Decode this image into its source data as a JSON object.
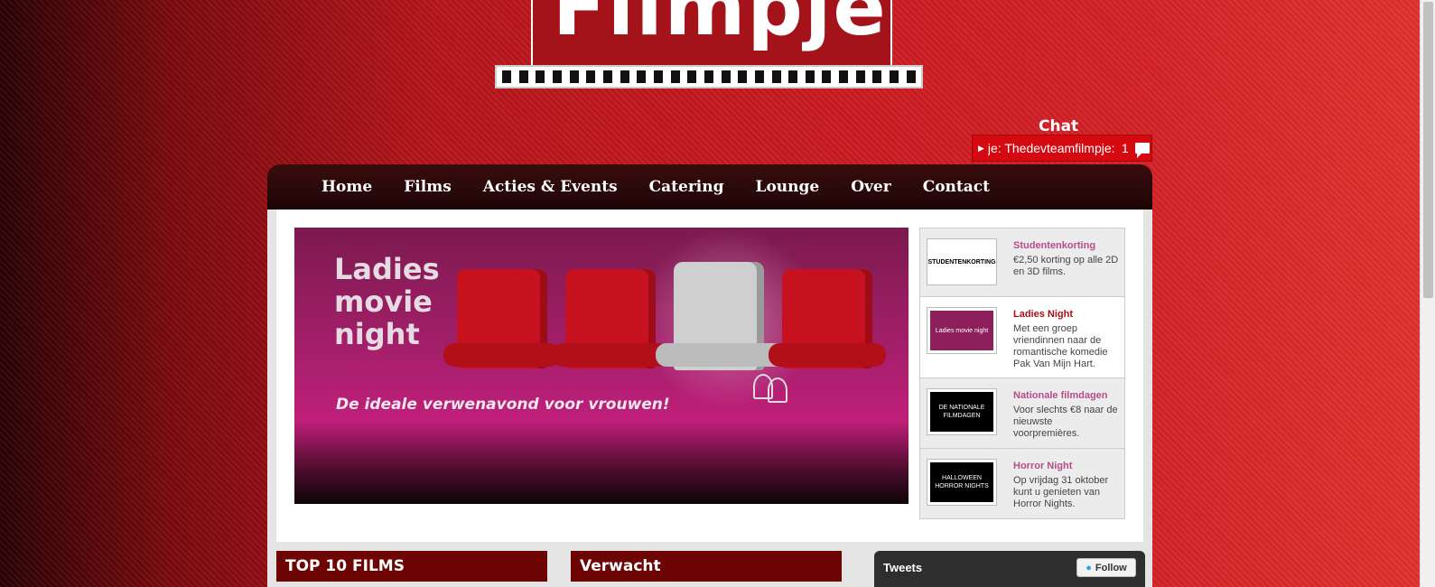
{
  "logo": {
    "text": "Filmpje"
  },
  "chat": {
    "title": "Chat",
    "ticker": "je: Thedevteamfilmpje: ",
    "count": "1"
  },
  "nav": {
    "items": [
      "Home",
      "Films",
      "Acties & Events",
      "Catering",
      "Lounge",
      "Over",
      "Contact"
    ]
  },
  "banner": {
    "title": "Ladies\nmovie\nnight",
    "tagline": "De ideale verwenavond voor vrouwen!"
  },
  "promos": [
    {
      "title": "Studentenkorting",
      "desc": "€2,50 korting op alle 2D en 3D films.",
      "thumb": "STUDENTENKORTING"
    },
    {
      "title": "Ladies Night",
      "desc": "Met een groep vriendinnen naar de romantische komedie Pak Van Mijn Hart.",
      "thumb": "Ladies movie night"
    },
    {
      "title": "Nationale filmdagen",
      "desc": "Voor slechts €8 naar de nieuwste voorpremières.",
      "thumb": "DE NATIONALE FILMDAGEN"
    },
    {
      "title": "Horror Night",
      "desc": "Op vrijdag 31 oktober kunt u genieten van Horror Nights.",
      "thumb": "HALLOWEEN HORROR NIGHTS"
    }
  ],
  "sections": {
    "top10": "TOP 10 FILMS",
    "expected": "Verwacht",
    "tweets": "Tweets",
    "follow": "Follow"
  }
}
